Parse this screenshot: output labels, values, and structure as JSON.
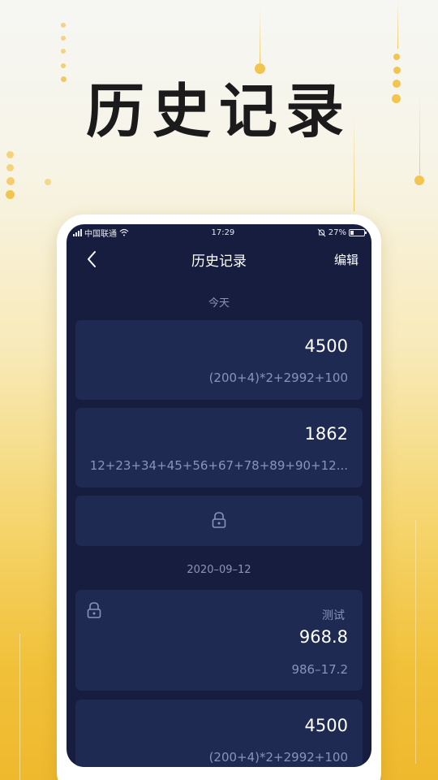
{
  "headline": "历史记录",
  "status_bar": {
    "carrier": "中国联通",
    "time": "17:29",
    "battery": "27%",
    "battery_level": 0.27
  },
  "nav": {
    "title": "历史记录",
    "edit_label": "编辑",
    "back_icon": "chevron-left-icon"
  },
  "sections": [
    {
      "label": "今天"
    },
    {
      "label": "2020–09–12"
    }
  ],
  "records": [
    {
      "result": "4500",
      "expression": "(200+4)*2+2992+100",
      "locked": false
    },
    {
      "result": "1862",
      "expression": "12+23+34+45+56+67+78+89+90+12...",
      "locked": false
    },
    {
      "locked": true,
      "icon": "lock-icon"
    },
    {
      "tag": "测试",
      "result": "968.8",
      "expression": "986–17.2",
      "locked": true,
      "icon": "lock-icon"
    },
    {
      "result": "4500",
      "expression": "(200+4)*2+2992+100",
      "locked": false
    }
  ],
  "colors": {
    "screen_bg": "#161d3f",
    "card_bg": "#1f2a52",
    "muted_text": "#8a92ba",
    "accent_gold": "#f2c450"
  }
}
